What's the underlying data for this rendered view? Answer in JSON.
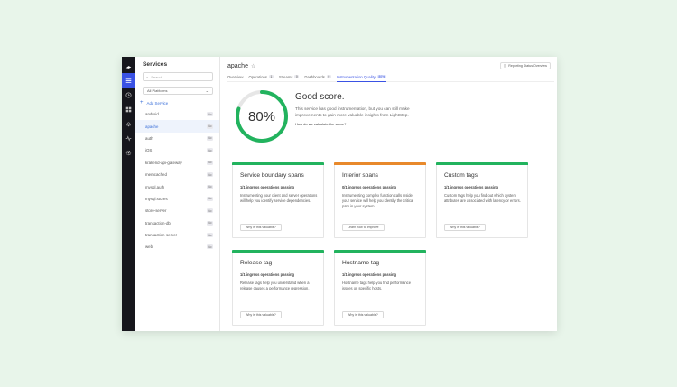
{
  "services_panel": {
    "title": "Services",
    "search_placeholder": "Search...",
    "platform_select": "All Platforms",
    "add_service": "Add Service",
    "items": [
      {
        "name": "android",
        "badge": "Go"
      },
      {
        "name": "apache",
        "badge": "Go",
        "selected": true
      },
      {
        "name": "auth",
        "badge": "Go"
      },
      {
        "name": "iOS",
        "badge": "Go"
      },
      {
        "name": "krakend-api-gateway",
        "badge": "Go"
      },
      {
        "name": "memcached",
        "badge": "Go"
      },
      {
        "name": "mysql.auth",
        "badge": "Go"
      },
      {
        "name": "mysql.stores",
        "badge": "Go"
      },
      {
        "name": "store-server",
        "badge": "Go"
      },
      {
        "name": "transaction-db",
        "badge": "Go"
      },
      {
        "name": "transaction-server",
        "badge": "Go"
      },
      {
        "name": "web",
        "badge": "Go"
      }
    ]
  },
  "header": {
    "service_name": "apache",
    "report_button": "Reporting Status Overview"
  },
  "tabs": [
    {
      "label": "Overview",
      "count": ""
    },
    {
      "label": "Operations",
      "count": "1"
    },
    {
      "label": "Streams",
      "count": "0"
    },
    {
      "label": "Dashboards",
      "count": "0"
    },
    {
      "label": "Instrumentation Quality",
      "count": "80%",
      "active": true
    }
  ],
  "score": {
    "percent_label": "80%",
    "value": 0.8,
    "title": "Good score.",
    "description": "This service has good instrumentation, but you can still make improvements to gain more valuable insights from LightStep.",
    "how_link": "How do we calculate the score?"
  },
  "cards": [
    {
      "title": "Service boundary spans",
      "status": "1/1 ingress operations passing",
      "desc": "Instrumenting your client and server operations will help you identify service dependencies.",
      "button": "Why is this valuable?",
      "color": "#22b35e"
    },
    {
      "title": "Interior spans",
      "status": "0/1 ingress operations passing",
      "desc": "Instrumenting complex function calls inside your service will help you identify the critical path in your system.",
      "button": "Learn how to improve",
      "color": "#e8892b"
    },
    {
      "title": "Custom tags",
      "status": "1/1 ingress operations passing",
      "desc": "Custom tags help you find out which system attributes are associated with latency or errors.",
      "button": "Why is this valuable?",
      "color": "#22b35e"
    },
    {
      "title": "Release tag",
      "status": "1/1 ingress operations passing",
      "desc": "Release tags help you understand when a release causes a performance regression.",
      "button": "Why is this valuable?",
      "color": "#22b35e"
    },
    {
      "title": "Hostname tag",
      "status": "1/1 ingress operations passing",
      "desc": "Hostname tags help you find performance issues on specific hosts.",
      "button": "Why is this valuable?",
      "color": "#22b35e"
    }
  ],
  "colors": {
    "accent": "#3a52e4",
    "rail": "#16161c",
    "ring": "#22b35e",
    "ring_track": "#e6e6e6"
  },
  "icons": {
    "rail": [
      "logo-icon",
      "list-icon",
      "clock-icon",
      "grid-icon",
      "bell-icon",
      "pulse-icon",
      "gear-icon"
    ]
  }
}
